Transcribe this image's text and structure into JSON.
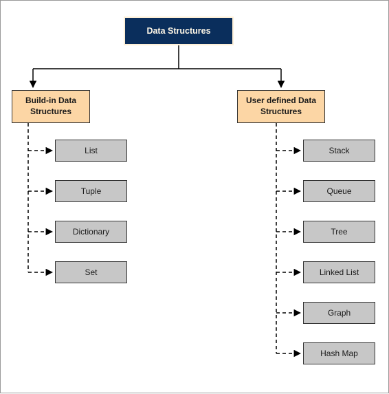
{
  "root": {
    "label": "Data Structures"
  },
  "categories": {
    "builtin": {
      "label": "Build-in Data\nStructures"
    },
    "userdefined": {
      "label": "User defined Data\nStructures"
    }
  },
  "builtin_items": [
    "List",
    "Tuple",
    "Dictionary",
    "Set"
  ],
  "userdefined_items": [
    "Stack",
    "Queue",
    "Tree",
    "Linked List",
    "Graph",
    "Hash Map"
  ]
}
